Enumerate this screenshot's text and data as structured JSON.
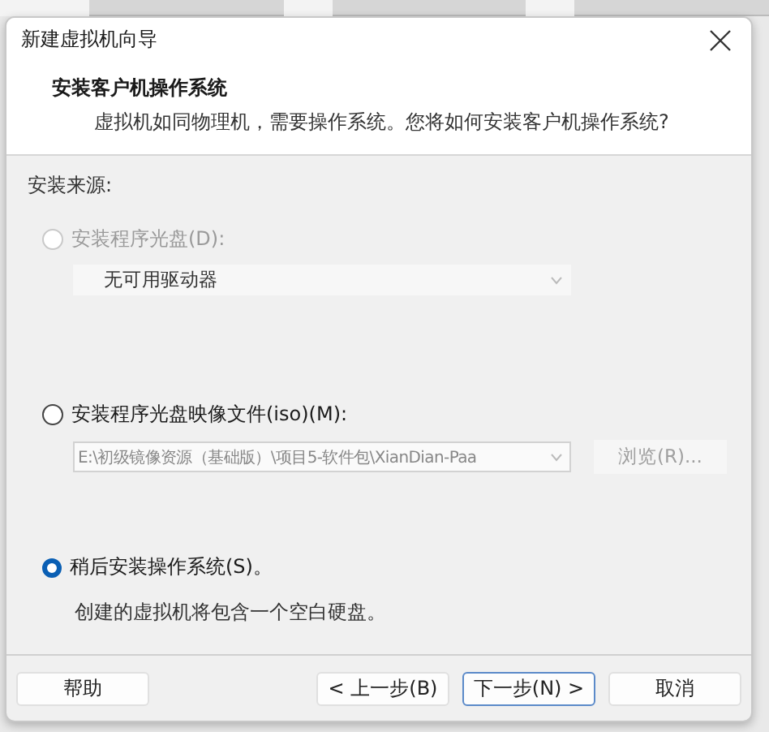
{
  "window": {
    "title": "新建虚拟机向导"
  },
  "header": {
    "title": "安装客户机操作系统",
    "subtitle": "虚拟机如同物理机，需要操作系统。您将如何安装客户机操作系统?"
  },
  "section_label": "安装来源:",
  "options": [
    {
      "kind": "drive",
      "label": "安装程序光盘(D):",
      "selected": false,
      "disabled": true,
      "value": "无可用驱动器"
    },
    {
      "kind": "iso",
      "label": "安装程序光盘映像文件(iso)(M):",
      "selected": false,
      "disabled": false,
      "value": "E:\\初级镜像资源（基础版）\\项目5-软件包\\XianDian-Paa",
      "browse": "浏览(R)..."
    },
    {
      "kind": "later",
      "label": "稍后安装操作系统(S)。",
      "selected": true,
      "disabled": false,
      "note": "创建的虚拟机将包含一个空白硬盘。"
    }
  ],
  "buttons": [
    {
      "label": "帮助",
      "focused": false
    },
    {
      "label": "< 上一步(B)",
      "focused": false
    },
    {
      "label": "下一步(N) >",
      "focused": true
    },
    {
      "label": "取消",
      "focused": false
    }
  ]
}
